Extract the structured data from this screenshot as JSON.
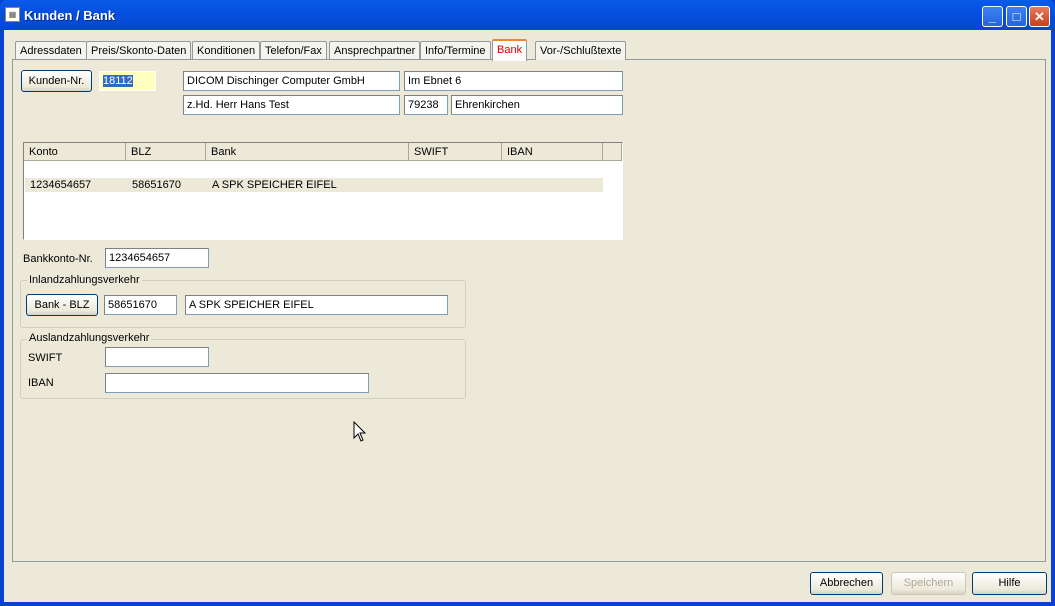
{
  "window": {
    "title": "Kunden / Bank",
    "minimize": "_",
    "maximize": "□",
    "close": "✕"
  },
  "tabs": [
    "Adressdaten",
    "Preis/Skonto-Daten",
    "Konditionen",
    "Telefon/Fax",
    "Ansprechpartner",
    "Info/Termine",
    "Bank",
    "Vor-/Schlußtexte"
  ],
  "active_tab": "Bank",
  "customer": {
    "button": "Kunden-Nr.",
    "number": "18112",
    "name": "DICOM Dischinger Computer GmbH",
    "street": "Im Ebnet 6",
    "contact": "z.Hd. Herr Hans Test",
    "zip": "79238",
    "city": "Ehrenkirchen"
  },
  "table": {
    "headers": [
      "Konto",
      "BLZ",
      "Bank",
      "SWIFT",
      "IBAN"
    ],
    "rows": [
      {
        "konto": "1234654657",
        "blz": "58651670",
        "bank": "A SPK SPEICHER EIFEL",
        "swift": "",
        "iban": ""
      }
    ]
  },
  "account": {
    "label": "Bankkonto-Nr.",
    "value": "1234654657"
  },
  "domestic": {
    "legend": "Inlandzahlungsverkehr",
    "button": "Bank - BLZ",
    "blz": "58651670",
    "bank": "A SPK SPEICHER EIFEL"
  },
  "foreign": {
    "legend": "Auslandzahlungsverkehr",
    "swift_label": "SWIFT",
    "swift": "",
    "iban_label": "IBAN",
    "iban": ""
  },
  "footer": {
    "cancel": "Abbrechen",
    "save": "Speichern",
    "help": "Hilfe"
  }
}
